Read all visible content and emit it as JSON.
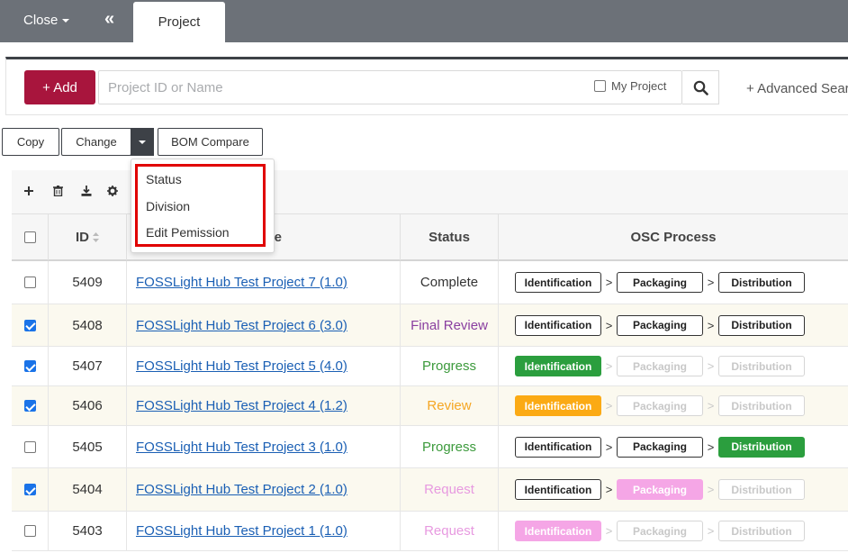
{
  "topbar": {
    "close_label": "Close",
    "collapse_icon": "«",
    "tab_label": "Project"
  },
  "search": {
    "add_label": "+ Add",
    "placeholder": "Project ID or Name",
    "my_project_label": "My Project",
    "advanced_label": "+ Advanced Search"
  },
  "toolbar": {
    "copy_label": "Copy",
    "change_label": "Change",
    "bom_compare_label": "BOM Compare"
  },
  "dropdown": {
    "items": [
      "Status",
      "Division",
      "Edit Pemission"
    ]
  },
  "table": {
    "headers": {
      "id": "ID",
      "name": "Name",
      "status": "Status",
      "osc": "OSC Process"
    },
    "rows": [
      {
        "id": "5409",
        "checked": false,
        "name": "FOSSLight Hub Test Project 7 (1.0)",
        "status": "Complete",
        "status_color": "#333333",
        "steps": [
          {
            "label": "Identification",
            "style": "outline"
          },
          {
            "label": "Packaging",
            "style": "outline"
          },
          {
            "label": "Distribution",
            "style": "outline"
          }
        ],
        "arrows": [
          "active",
          "active"
        ]
      },
      {
        "id": "5408",
        "checked": true,
        "name": "FOSSLight Hub Test Project 6 (3.0)",
        "status": "Final Review",
        "status_color": "#8a3fa0",
        "steps": [
          {
            "label": "Identification",
            "style": "outline"
          },
          {
            "label": "Packaging",
            "style": "outline"
          },
          {
            "label": "Distribution",
            "style": "outline"
          }
        ],
        "arrows": [
          "active",
          "active"
        ]
      },
      {
        "id": "5407",
        "checked": true,
        "name": "FOSSLight Hub Test Project 5 (4.0)",
        "status": "Progress",
        "status_color": "#3c9a3c",
        "steps": [
          {
            "label": "Identification",
            "style": "green"
          },
          {
            "label": "Packaging",
            "style": "faded"
          },
          {
            "label": "Distribution",
            "style": "faded"
          }
        ],
        "arrows": [
          "faded",
          "faded"
        ]
      },
      {
        "id": "5406",
        "checked": true,
        "name": "FOSSLight Hub Test Project 4 (1.2)",
        "status": "Review",
        "status_color": "#f5a623",
        "steps": [
          {
            "label": "Identification",
            "style": "orange"
          },
          {
            "label": "Packaging",
            "style": "faded"
          },
          {
            "label": "Distribution",
            "style": "faded"
          }
        ],
        "arrows": [
          "faded",
          "faded"
        ]
      },
      {
        "id": "5405",
        "checked": false,
        "name": "FOSSLight Hub Test Project 3 (1.0)",
        "status": "Progress",
        "status_color": "#3c9a3c",
        "steps": [
          {
            "label": "Identification",
            "style": "outline"
          },
          {
            "label": "Packaging",
            "style": "outline"
          },
          {
            "label": "Distribution",
            "style": "green"
          }
        ],
        "arrows": [
          "active",
          "active"
        ]
      },
      {
        "id": "5404",
        "checked": true,
        "name": "FOSSLight Hub Test Project 2 (1.0)",
        "status": "Request",
        "status_color": "#e79ae0",
        "steps": [
          {
            "label": "Identification",
            "style": "outline"
          },
          {
            "label": "Packaging",
            "style": "pink"
          },
          {
            "label": "Distribution",
            "style": "faded"
          }
        ],
        "arrows": [
          "active",
          "faded"
        ]
      },
      {
        "id": "5403",
        "checked": false,
        "name": "FOSSLight Hub Test Project 1 (1.0)",
        "status": "Request",
        "status_color": "#e79ae0",
        "steps": [
          {
            "label": "Identification",
            "style": "pink"
          },
          {
            "label": "Packaging",
            "style": "faded"
          },
          {
            "label": "Distribution",
            "style": "faded"
          }
        ],
        "arrows": [
          "faded",
          "faded"
        ]
      }
    ]
  }
}
